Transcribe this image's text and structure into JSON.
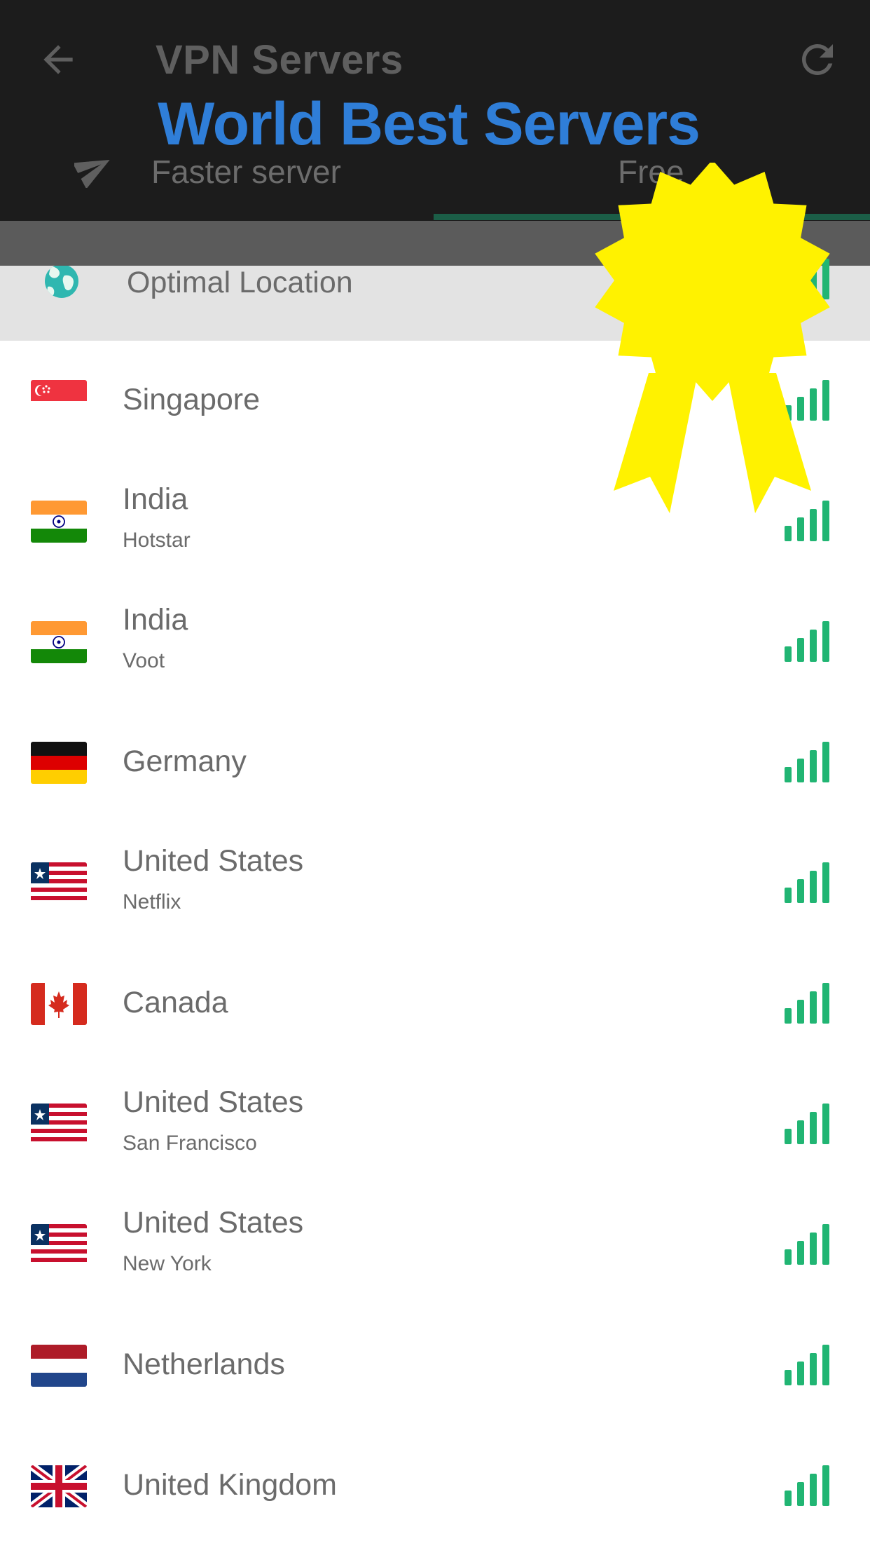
{
  "header": {
    "title": "VPN Servers",
    "banner": "World Best Servers",
    "tabs": [
      {
        "label": "Faster server",
        "icon": "paper-plane-icon"
      },
      {
        "label": "Free",
        "selected": true
      }
    ],
    "back_icon": "arrow-left-icon",
    "refresh_icon": "refresh-icon"
  },
  "colors": {
    "header_bg": "#1c1c1c",
    "banner_text": "#2f7ed8",
    "signal": "#21b573",
    "badge": "#fff200",
    "tab_indicator": "#1b5e47"
  },
  "optimal": {
    "label": "Optimal Location",
    "icon": "globe-icon"
  },
  "servers": [
    {
      "name": "Singapore",
      "sub": "",
      "flag": "singapore-flag-icon"
    },
    {
      "name": "India",
      "sub": "Hotstar",
      "flag": "india-flag-icon"
    },
    {
      "name": "India",
      "sub": "Voot",
      "flag": "india-flag-icon"
    },
    {
      "name": "Germany",
      "sub": "",
      "flag": "germany-flag-icon"
    },
    {
      "name": "United States",
      "sub": "Netflix",
      "flag": "usa-flag-icon"
    },
    {
      "name": "Canada",
      "sub": "",
      "flag": "canada-flag-icon"
    },
    {
      "name": "United States",
      "sub": "San Francisco",
      "flag": "usa-flag-icon"
    },
    {
      "name": "United States",
      "sub": "New York",
      "flag": "usa-flag-icon"
    },
    {
      "name": "Netherlands",
      "sub": "",
      "flag": "netherlands-flag-icon"
    },
    {
      "name": "United Kingdom",
      "sub": "",
      "flag": "uk-flag-icon"
    }
  ],
  "badge_icon": "award-ribbon-star-icon"
}
